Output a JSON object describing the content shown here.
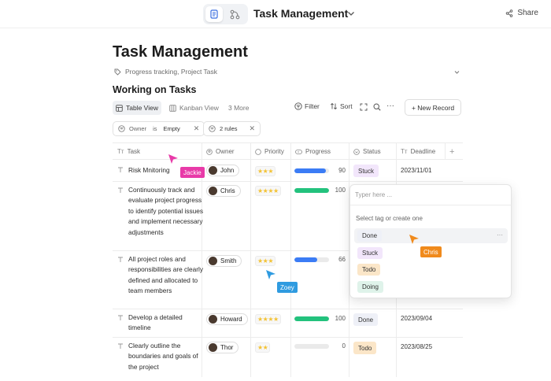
{
  "app": {
    "title": "Task Management",
    "share_label": "Share"
  },
  "page": {
    "title": "Task Management",
    "meta": "Progress tracking, Project Task",
    "section_title": "Working on Tasks"
  },
  "toolbar": {
    "tabs": [
      {
        "label": "Table View",
        "icon": "table-icon",
        "active": true
      },
      {
        "label": "Kanban View",
        "icon": "kanban-icon",
        "active": false
      },
      {
        "label": "3 More",
        "icon": "",
        "active": false
      }
    ],
    "filter_label": "Filter",
    "sort_label": "Sort",
    "new_record_label": "+ New Record"
  },
  "filters": {
    "field": "Owner",
    "operator": "is",
    "value": "Empty",
    "rules_label": "2 rules"
  },
  "columns": {
    "task": "Task",
    "owner": "Owner",
    "priority": "Priority",
    "progress": "Progress",
    "status": "Status",
    "deadline": "Deadline"
  },
  "rows": [
    {
      "task": "Risk Mnitoring",
      "owner": "John",
      "stars": "★★★",
      "progress": 90,
      "progress_label": "90",
      "progress_color": "#3b7cf5",
      "status": "Stuck",
      "status_color": "#f2e6fb",
      "deadline": "2023/11/01"
    },
    {
      "task": "Continuously track and evaluate project progress to identify potential issues and implement necessary adjustments",
      "owner": "Chris",
      "stars": "★★★★",
      "progress": 100,
      "progress_label": "100",
      "progress_color": "#23c27d",
      "status": "",
      "status_color": "",
      "deadline": ""
    },
    {
      "task": "All project roles and responsibilities are clearly defined and allocated to team members",
      "owner": "Smith",
      "stars": "★★★",
      "progress": 66,
      "progress_label": "66",
      "progress_color": "#3b7cf5",
      "status": "",
      "status_color": "",
      "deadline": ""
    },
    {
      "task": "Develop a detailed timeline",
      "owner": "Howard",
      "stars": "★★★★",
      "progress": 100,
      "progress_label": "100",
      "progress_color": "#23c27d",
      "status": "Done",
      "status_color": "#eef0f7",
      "deadline": "2023/09/04"
    },
    {
      "task": "Clearly outline the boundaries and goals of the project",
      "owner": "Thor",
      "stars": "★★",
      "progress": 0,
      "progress_label": "0",
      "progress_color": "#3b7cf5",
      "status": "Todo",
      "status_color": "#fbe6c8",
      "deadline": "2023/08/25"
    }
  ],
  "dropdown": {
    "placeholder": "Typer here ...",
    "hint": "Select tag or create one",
    "more": "···",
    "options": [
      {
        "label": "Done",
        "color": "#eef0f7"
      },
      {
        "label": "Stuck",
        "color": "#f2e6fb"
      },
      {
        "label": "Todo",
        "color": "#fbe6c8"
      },
      {
        "label": "Doing",
        "color": "#dff3ea"
      }
    ]
  },
  "cursors": [
    {
      "name": "Jackie",
      "color": "#e83aa8"
    },
    {
      "name": "Zoey",
      "color": "#2f9be0"
    },
    {
      "name": "Chris",
      "color": "#f08a1c"
    }
  ]
}
